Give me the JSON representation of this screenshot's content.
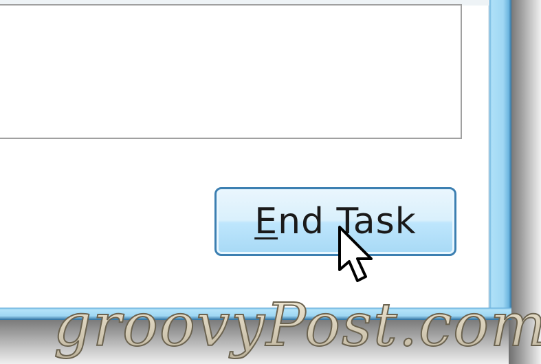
{
  "dialog": {
    "end_task_button": {
      "label_mnemonic": "E",
      "label_rest": "nd Task"
    }
  },
  "watermark": {
    "text": "groovyPost.com"
  },
  "colors": {
    "frame_blue": "#8fd0f0",
    "button_border": "#3c7fb1",
    "button_top": "#eaf6fd",
    "button_bottom": "#a7d9f5",
    "list_border": "#a0a0a0"
  },
  "icons": {
    "cursor": "arrow-pointer-icon"
  }
}
